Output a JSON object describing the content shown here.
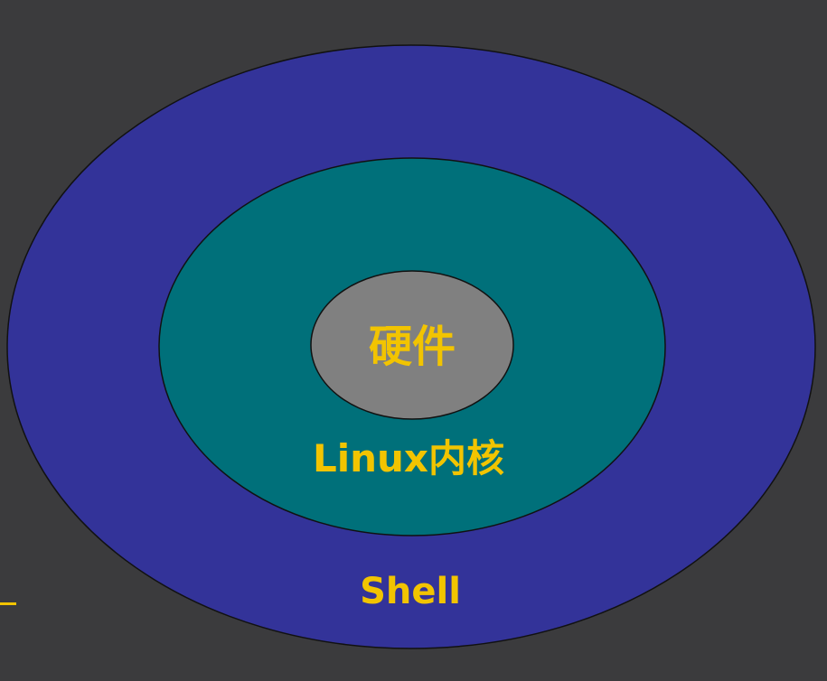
{
  "diagram": {
    "layers": [
      {
        "id": "shell",
        "label": "Shell",
        "fill": "#333399"
      },
      {
        "id": "kernel",
        "label": "Linux内核",
        "fill": "#00707a"
      },
      {
        "id": "hardware",
        "label": "硬件",
        "fill": "#808080"
      }
    ],
    "label_color": "#f2c400",
    "outline_color": "#111111",
    "background": "#3b3b3d"
  }
}
